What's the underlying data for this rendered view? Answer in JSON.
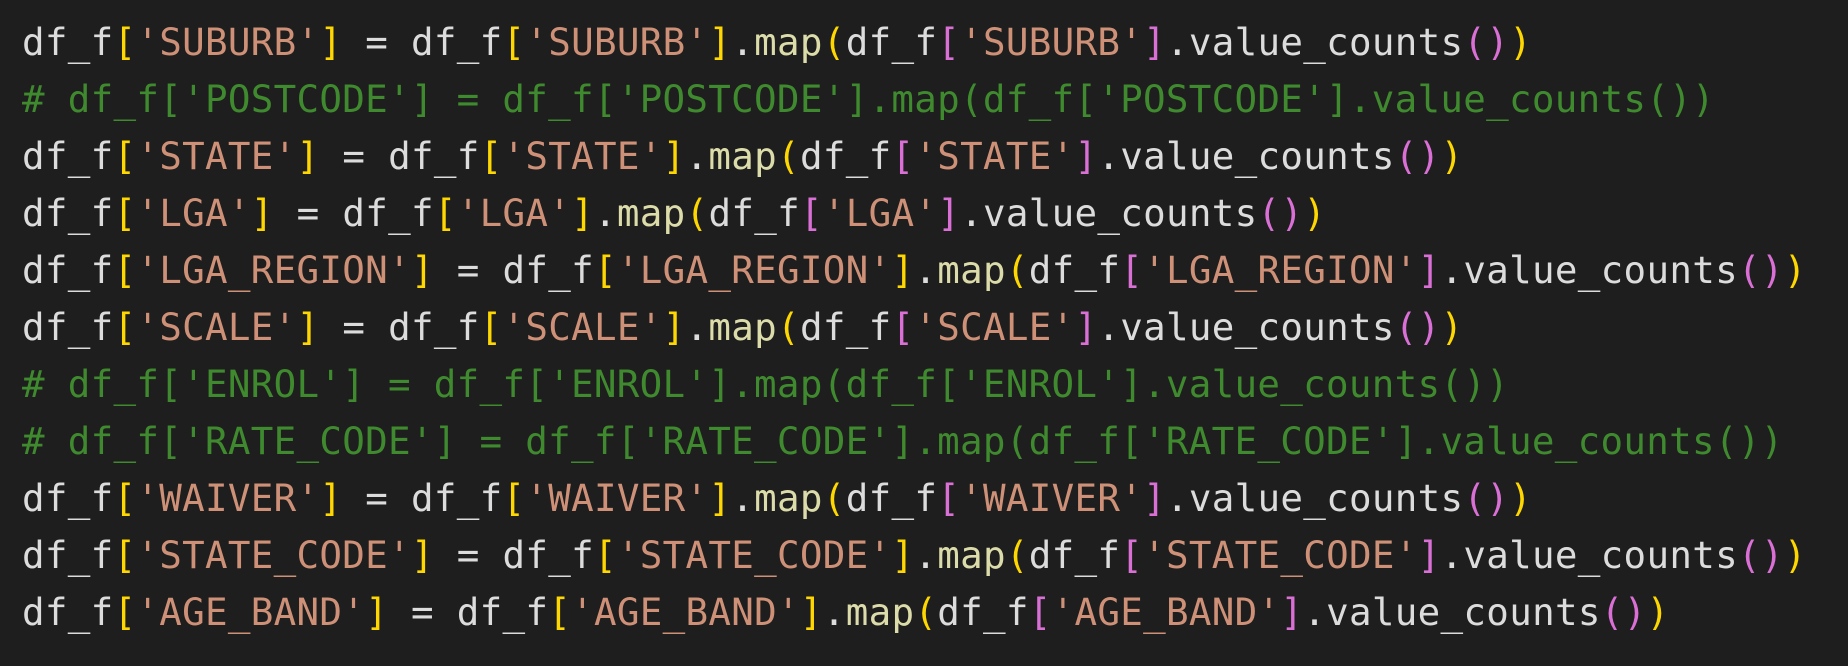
{
  "editor": {
    "background": "#1e1e1e",
    "language": "python",
    "lines": [
      {
        "tokens": [
          {
            "t": "df_f",
            "c": "#dcdcdc"
          },
          {
            "t": "[",
            "c": "#ffd700"
          },
          {
            "t": "'SUBURB'",
            "c": "#ce9178"
          },
          {
            "t": "]",
            "c": "#ffd700"
          },
          {
            "t": " = ",
            "c": "#dcdcdc"
          },
          {
            "t": "df_f",
            "c": "#dcdcdc"
          },
          {
            "t": "[",
            "c": "#ffd700"
          },
          {
            "t": "'SUBURB'",
            "c": "#ce9178"
          },
          {
            "t": "]",
            "c": "#ffd700"
          },
          {
            "t": ".",
            "c": "#dcdcdc"
          },
          {
            "t": "map",
            "c": "#dcdcaa"
          },
          {
            "t": "(",
            "c": "#ffd700"
          },
          {
            "t": "df_f",
            "c": "#dcdcdc"
          },
          {
            "t": "[",
            "c": "#da70d6"
          },
          {
            "t": "'SUBURB'",
            "c": "#ce9178"
          },
          {
            "t": "]",
            "c": "#da70d6"
          },
          {
            "t": ".value_counts",
            "c": "#dcdcdc"
          },
          {
            "t": "()",
            "c": "#da70d6"
          },
          {
            "t": ")",
            "c": "#ffd700"
          }
        ]
      },
      {
        "tokens": [
          {
            "t": "# df_f['POSTCODE'] = df_f['POSTCODE'].map(df_f['POSTCODE'].value_counts())",
            "c": "#3f8a2e"
          }
        ]
      },
      {
        "tokens": [
          {
            "t": "df_f",
            "c": "#dcdcdc"
          },
          {
            "t": "[",
            "c": "#ffd700"
          },
          {
            "t": "'STATE'",
            "c": "#ce9178"
          },
          {
            "t": "]",
            "c": "#ffd700"
          },
          {
            "t": " = ",
            "c": "#dcdcdc"
          },
          {
            "t": "df_f",
            "c": "#dcdcdc"
          },
          {
            "t": "[",
            "c": "#ffd700"
          },
          {
            "t": "'STATE'",
            "c": "#ce9178"
          },
          {
            "t": "]",
            "c": "#ffd700"
          },
          {
            "t": ".",
            "c": "#dcdcdc"
          },
          {
            "t": "map",
            "c": "#dcdcaa"
          },
          {
            "t": "(",
            "c": "#ffd700"
          },
          {
            "t": "df_f",
            "c": "#dcdcdc"
          },
          {
            "t": "[",
            "c": "#da70d6"
          },
          {
            "t": "'STATE'",
            "c": "#ce9178"
          },
          {
            "t": "]",
            "c": "#da70d6"
          },
          {
            "t": ".value_counts",
            "c": "#dcdcdc"
          },
          {
            "t": "()",
            "c": "#da70d6"
          },
          {
            "t": ")",
            "c": "#ffd700"
          }
        ]
      },
      {
        "tokens": [
          {
            "t": "df_f",
            "c": "#dcdcdc"
          },
          {
            "t": "[",
            "c": "#ffd700"
          },
          {
            "t": "'LGA'",
            "c": "#ce9178"
          },
          {
            "t": "]",
            "c": "#ffd700"
          },
          {
            "t": " = ",
            "c": "#dcdcdc"
          },
          {
            "t": "df_f",
            "c": "#dcdcdc"
          },
          {
            "t": "[",
            "c": "#ffd700"
          },
          {
            "t": "'LGA'",
            "c": "#ce9178"
          },
          {
            "t": "]",
            "c": "#ffd700"
          },
          {
            "t": ".",
            "c": "#dcdcdc"
          },
          {
            "t": "map",
            "c": "#dcdcaa"
          },
          {
            "t": "(",
            "c": "#ffd700"
          },
          {
            "t": "df_f",
            "c": "#dcdcdc"
          },
          {
            "t": "[",
            "c": "#da70d6"
          },
          {
            "t": "'LGA'",
            "c": "#ce9178"
          },
          {
            "t": "]",
            "c": "#da70d6"
          },
          {
            "t": ".value_counts",
            "c": "#dcdcdc"
          },
          {
            "t": "()",
            "c": "#da70d6"
          },
          {
            "t": ")",
            "c": "#ffd700"
          }
        ]
      },
      {
        "tokens": [
          {
            "t": "df_f",
            "c": "#dcdcdc"
          },
          {
            "t": "[",
            "c": "#ffd700"
          },
          {
            "t": "'LGA_REGION'",
            "c": "#ce9178"
          },
          {
            "t": "]",
            "c": "#ffd700"
          },
          {
            "t": " = ",
            "c": "#dcdcdc"
          },
          {
            "t": "df_f",
            "c": "#dcdcdc"
          },
          {
            "t": "[",
            "c": "#ffd700"
          },
          {
            "t": "'LGA_REGION'",
            "c": "#ce9178"
          },
          {
            "t": "]",
            "c": "#ffd700"
          },
          {
            "t": ".",
            "c": "#dcdcdc"
          },
          {
            "t": "map",
            "c": "#dcdcaa"
          },
          {
            "t": "(",
            "c": "#ffd700"
          },
          {
            "t": "df_f",
            "c": "#dcdcdc"
          },
          {
            "t": "[",
            "c": "#da70d6"
          },
          {
            "t": "'LGA_REGION'",
            "c": "#ce9178"
          },
          {
            "t": "]",
            "c": "#da70d6"
          },
          {
            "t": ".value_counts",
            "c": "#dcdcdc"
          },
          {
            "t": "()",
            "c": "#da70d6"
          },
          {
            "t": ")",
            "c": "#ffd700"
          }
        ]
      },
      {
        "tokens": [
          {
            "t": "df_f",
            "c": "#dcdcdc"
          },
          {
            "t": "[",
            "c": "#ffd700"
          },
          {
            "t": "'SCALE'",
            "c": "#ce9178"
          },
          {
            "t": "]",
            "c": "#ffd700"
          },
          {
            "t": " = ",
            "c": "#dcdcdc"
          },
          {
            "t": "df_f",
            "c": "#dcdcdc"
          },
          {
            "t": "[",
            "c": "#ffd700"
          },
          {
            "t": "'SCALE'",
            "c": "#ce9178"
          },
          {
            "t": "]",
            "c": "#ffd700"
          },
          {
            "t": ".",
            "c": "#dcdcdc"
          },
          {
            "t": "map",
            "c": "#dcdcaa"
          },
          {
            "t": "(",
            "c": "#ffd700"
          },
          {
            "t": "df_f",
            "c": "#dcdcdc"
          },
          {
            "t": "[",
            "c": "#da70d6"
          },
          {
            "t": "'SCALE'",
            "c": "#ce9178"
          },
          {
            "t": "]",
            "c": "#da70d6"
          },
          {
            "t": ".value_counts",
            "c": "#dcdcdc"
          },
          {
            "t": "()",
            "c": "#da70d6"
          },
          {
            "t": ")",
            "c": "#ffd700"
          }
        ]
      },
      {
        "tokens": [
          {
            "t": "# df_f['ENROL'] = df_f['ENROL'].map(df_f['ENROL'].value_counts())",
            "c": "#3f8a2e"
          }
        ]
      },
      {
        "tokens": [
          {
            "t": "# df_f['RATE_CODE'] = df_f['RATE_CODE'].map(df_f['RATE_CODE'].value_counts())",
            "c": "#3f8a2e"
          }
        ]
      },
      {
        "tokens": [
          {
            "t": "df_f",
            "c": "#dcdcdc"
          },
          {
            "t": "[",
            "c": "#ffd700"
          },
          {
            "t": "'WAIVER'",
            "c": "#ce9178"
          },
          {
            "t": "]",
            "c": "#ffd700"
          },
          {
            "t": " = ",
            "c": "#dcdcdc"
          },
          {
            "t": "df_f",
            "c": "#dcdcdc"
          },
          {
            "t": "[",
            "c": "#ffd700"
          },
          {
            "t": "'WAIVER'",
            "c": "#ce9178"
          },
          {
            "t": "]",
            "c": "#ffd700"
          },
          {
            "t": ".",
            "c": "#dcdcdc"
          },
          {
            "t": "map",
            "c": "#dcdcaa"
          },
          {
            "t": "(",
            "c": "#ffd700"
          },
          {
            "t": "df_f",
            "c": "#dcdcdc"
          },
          {
            "t": "[",
            "c": "#da70d6"
          },
          {
            "t": "'WAIVER'",
            "c": "#ce9178"
          },
          {
            "t": "]",
            "c": "#da70d6"
          },
          {
            "t": ".value_counts",
            "c": "#dcdcdc"
          },
          {
            "t": "()",
            "c": "#da70d6"
          },
          {
            "t": ")",
            "c": "#ffd700"
          }
        ]
      },
      {
        "tokens": [
          {
            "t": "df_f",
            "c": "#dcdcdc"
          },
          {
            "t": "[",
            "c": "#ffd700"
          },
          {
            "t": "'STATE_CODE'",
            "c": "#ce9178"
          },
          {
            "t": "]",
            "c": "#ffd700"
          },
          {
            "t": " = ",
            "c": "#dcdcdc"
          },
          {
            "t": "df_f",
            "c": "#dcdcdc"
          },
          {
            "t": "[",
            "c": "#ffd700"
          },
          {
            "t": "'STATE_CODE'",
            "c": "#ce9178"
          },
          {
            "t": "]",
            "c": "#ffd700"
          },
          {
            "t": ".",
            "c": "#dcdcdc"
          },
          {
            "t": "map",
            "c": "#dcdcaa"
          },
          {
            "t": "(",
            "c": "#ffd700"
          },
          {
            "t": "df_f",
            "c": "#dcdcdc"
          },
          {
            "t": "[",
            "c": "#da70d6"
          },
          {
            "t": "'STATE_CODE'",
            "c": "#ce9178"
          },
          {
            "t": "]",
            "c": "#da70d6"
          },
          {
            "t": ".value_counts",
            "c": "#dcdcdc"
          },
          {
            "t": "()",
            "c": "#da70d6"
          },
          {
            "t": ")",
            "c": "#ffd700"
          }
        ]
      },
      {
        "tokens": [
          {
            "t": "df_f",
            "c": "#dcdcdc"
          },
          {
            "t": "[",
            "c": "#ffd700"
          },
          {
            "t": "'AGE_BAND'",
            "c": "#ce9178"
          },
          {
            "t": "]",
            "c": "#ffd700"
          },
          {
            "t": " = ",
            "c": "#dcdcdc"
          },
          {
            "t": "df_f",
            "c": "#dcdcdc"
          },
          {
            "t": "[",
            "c": "#ffd700"
          },
          {
            "t": "'AGE_BAND'",
            "c": "#ce9178"
          },
          {
            "t": "]",
            "c": "#ffd700"
          },
          {
            "t": ".",
            "c": "#dcdcdc"
          },
          {
            "t": "map",
            "c": "#dcdcaa"
          },
          {
            "t": "(",
            "c": "#ffd700"
          },
          {
            "t": "df_f",
            "c": "#dcdcdc"
          },
          {
            "t": "[",
            "c": "#da70d6"
          },
          {
            "t": "'AGE_BAND'",
            "c": "#ce9178"
          },
          {
            "t": "]",
            "c": "#da70d6"
          },
          {
            "t": ".value_counts",
            "c": "#dcdcdc"
          },
          {
            "t": "()",
            "c": "#da70d6"
          },
          {
            "t": ")",
            "c": "#ffd700"
          }
        ]
      }
    ]
  }
}
